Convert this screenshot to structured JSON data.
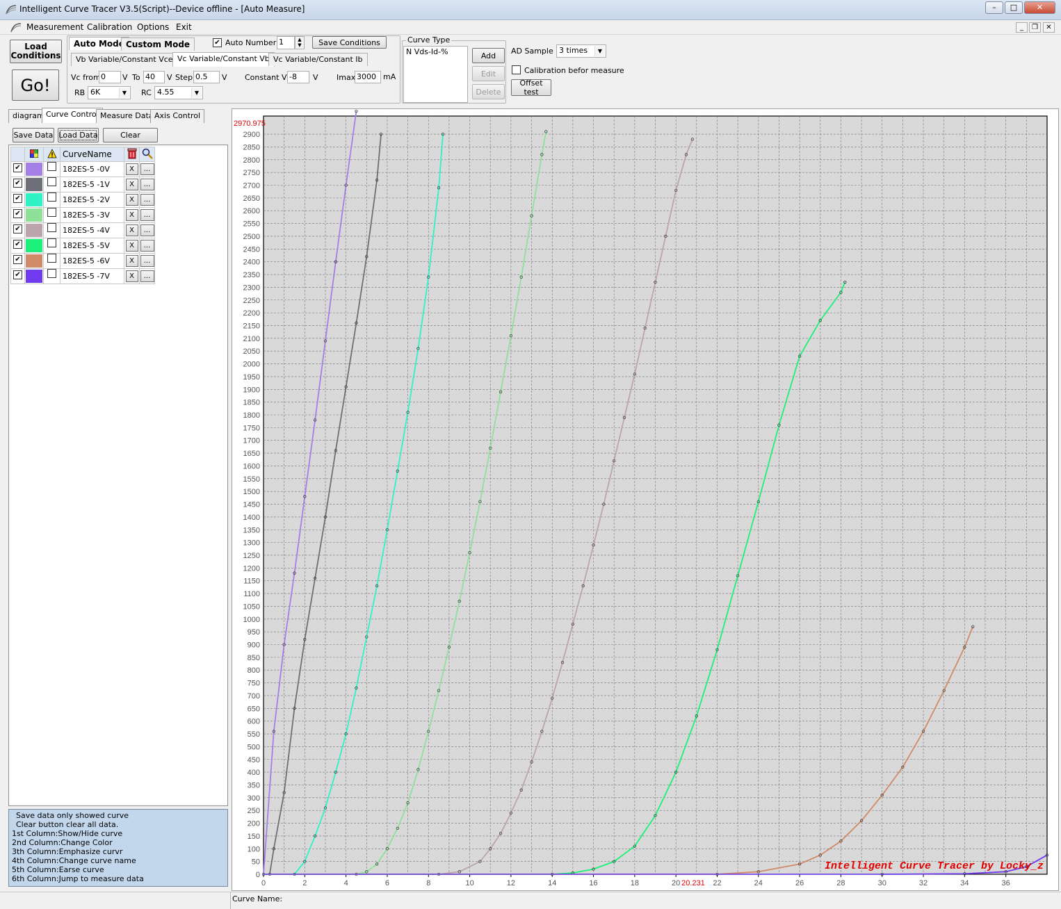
{
  "window": {
    "title": "Intelligent Curve Tracer V3.5(Script)--Device offline - [Auto Measure]",
    "minimize": "0",
    "maximize": "1",
    "close": "X"
  },
  "menu": [
    "Measurement",
    "Calibration",
    "Options",
    "Exit"
  ],
  "toolbar": {
    "load_line1": "Load",
    "load_line2": "Conditions",
    "go_label": "Go!",
    "mode_tabs": [
      "Auto Mode",
      "Custom Mode"
    ],
    "auto_number_label": "Auto Number",
    "auto_number_checked": true,
    "auto_number_value": "1",
    "save_conditions": "Save Conditions",
    "sub_tabs": [
      "Vb Variable/Constant Vce",
      "Vc Variable/Constant Vb",
      "Vc Variable/Constant Ib"
    ],
    "vc_from_label": "Vc from",
    "vc_from_value": "0",
    "unit_v": "V",
    "to_label": "To",
    "to_value": "40",
    "step_label": "Step",
    "step_value": "0.5",
    "constant_vb_label": "Constant Vb",
    "constant_vb_value": "-8",
    "imax_label": "Imax",
    "imax_value": "3000",
    "unit_ma": "mA",
    "rb_label": "RB",
    "rb_value": "6K",
    "rc_label": "RC",
    "rc_value": "4.55"
  },
  "curve_type": {
    "label": "Curve Type",
    "item": "N Vds-Id-%",
    "add": "Add",
    "edit": "Edit",
    "delete": "Delete"
  },
  "ad": {
    "label": "AD Sample",
    "value": "3 times",
    "calib_label": "Calibration befor measure",
    "calib_checked": false,
    "offset_test": "Offset test"
  },
  "left_tabs": [
    "diagram",
    "Curve Control",
    "Measure Data",
    "Axis Control"
  ],
  "left_buttons": {
    "save": "Save Data",
    "load": "Load Data",
    "clear": "Clear"
  },
  "curve_table": {
    "header": "CurveName",
    "x_label": "X",
    "more_label": "...",
    "rows": [
      {
        "name": "182ES-5 -0V",
        "color": "#a47fe6",
        "shown": true
      },
      {
        "name": "182ES-5 -1V",
        "color": "#6e6e78",
        "shown": true
      },
      {
        "name": "182ES-5 -2V",
        "color": "#2ef3c4",
        "shown": true
      },
      {
        "name": "182ES-5 -3V",
        "color": "#8fe19a",
        "shown": true
      },
      {
        "name": "182ES-5 -4V",
        "color": "#bba4ae",
        "shown": true
      },
      {
        "name": "182ES-5 -5V",
        "color": "#1cf07a",
        "shown": true
      },
      {
        "name": "182ES-5 -6V",
        "color": "#d08a68",
        "shown": true
      },
      {
        "name": "182ES-5 -7V",
        "color": "#6f3af0",
        "shown": true
      }
    ]
  },
  "help_lines": [
    "Save data only showed curve",
    "Clear button clear all data.",
    "1st Column:Show/Hide curve",
    "2nd Column:Change Color",
    "3th Column:Emphasize curvr",
    "4th Column:Change curve name",
    "5th Column:Earse curve",
    "6th Column:Jump to measure data"
  ],
  "status": {
    "curve_name_label": "Curve Name:"
  },
  "chart_data": {
    "type": "line",
    "title": "",
    "xlabel": "",
    "ylabel": "",
    "xlim": [
      0,
      38
    ],
    "ylim": [
      0,
      2970.975
    ],
    "x_ticks": [
      0,
      2,
      4,
      6,
      8,
      10,
      12,
      14,
      16,
      18,
      20,
      22,
      24,
      26,
      28,
      30,
      32,
      34,
      36
    ],
    "y_tick_step": 50,
    "grid": true,
    "y_max_readout": "2970.975",
    "cursor_x_readout": "20.231",
    "watermark": "Intelligent Curve Tracer by Locky_z",
    "series": [
      {
        "name": "182ES-5 -0V",
        "color": "#a47fe6",
        "x": [
          0,
          0.5,
          1.0,
          1.5,
          2.0,
          2.5,
          3.0,
          3.5,
          4.0,
          4.5
        ],
        "y": [
          0,
          560,
          900,
          1180,
          1480,
          1780,
          2090,
          2400,
          2700,
          2990
        ]
      },
      {
        "name": "182ES-5 -1V",
        "color": "#6e6e78",
        "x": [
          0.3,
          0.5,
          1.0,
          1.5,
          2.0,
          2.5,
          3.0,
          3.5,
          4.0,
          4.5,
          5.0,
          5.5,
          5.7
        ],
        "y": [
          0,
          100,
          320,
          650,
          920,
          1160,
          1400,
          1660,
          1910,
          2160,
          2420,
          2720,
          2900
        ]
      },
      {
        "name": "182ES-5 -2V",
        "color": "#2ef3c4",
        "x": [
          1.5,
          2.0,
          2.5,
          3.0,
          3.5,
          4.0,
          4.5,
          5.0,
          5.5,
          6.0,
          6.5,
          7.0,
          7.5,
          8.0,
          8.5,
          8.7
        ],
        "y": [
          0,
          50,
          150,
          260,
          400,
          550,
          730,
          930,
          1130,
          1350,
          1580,
          1810,
          2060,
          2340,
          2690,
          2900
        ]
      },
      {
        "name": "182ES-5 -3V",
        "color": "#8fe19a",
        "x": [
          4.5,
          5.0,
          5.5,
          6.0,
          6.5,
          7.0,
          7.5,
          8.0,
          8.5,
          9.0,
          9.5,
          10.0,
          10.5,
          11.0,
          11.5,
          12.0,
          12.5,
          13.0,
          13.5,
          13.7
        ],
        "y": [
          0,
          10,
          40,
          100,
          180,
          280,
          410,
          560,
          720,
          890,
          1070,
          1260,
          1460,
          1670,
          1890,
          2110,
          2340,
          2580,
          2820,
          2910
        ]
      },
      {
        "name": "182ES-5 -4V",
        "color": "#bba4ae",
        "x": [
          8.5,
          9.5,
          10.5,
          11.0,
          11.5,
          12.0,
          12.5,
          13.0,
          13.5,
          14.0,
          14.5,
          15.0,
          15.5,
          16.0,
          16.5,
          17.0,
          17.5,
          18.0,
          18.5,
          19.0,
          19.5,
          20.0,
          20.5,
          20.8
        ],
        "y": [
          0,
          10,
          50,
          100,
          160,
          240,
          330,
          440,
          560,
          690,
          830,
          980,
          1130,
          1290,
          1450,
          1620,
          1790,
          1960,
          2140,
          2320,
          2500,
          2680,
          2820,
          2880
        ]
      },
      {
        "name": "182ES-5 -5V",
        "color": "#1cf07a",
        "x": [
          14.0,
          15.0,
          16.0,
          17.0,
          18.0,
          19.0,
          20.0,
          21.0,
          22.0,
          23.0,
          24.0,
          25.0,
          26.0,
          27.0,
          28.0,
          28.2
        ],
        "y": [
          0,
          5,
          20,
          50,
          110,
          230,
          400,
          620,
          880,
          1170,
          1460,
          1760,
          2030,
          2170,
          2280,
          2320
        ]
      },
      {
        "name": "182ES-5 -6V",
        "color": "#d08a68",
        "x": [
          22.0,
          24.0,
          26.0,
          27.0,
          28.0,
          29.0,
          30.0,
          31.0,
          32.0,
          33.0,
          34.0,
          34.4
        ],
        "y": [
          0,
          10,
          40,
          75,
          130,
          210,
          310,
          420,
          560,
          720,
          890,
          970
        ]
      },
      {
        "name": "182ES-5 -7V",
        "color": "#6f3af0",
        "x": [
          30.0,
          34.0,
          36.0,
          37.0,
          38.0
        ],
        "y": [
          0,
          2,
          10,
          30,
          75
        ]
      }
    ]
  }
}
